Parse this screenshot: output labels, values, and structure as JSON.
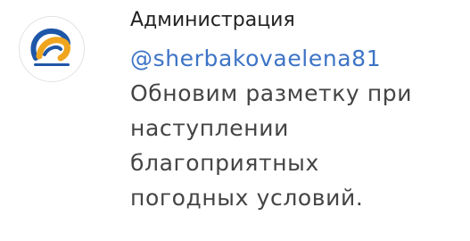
{
  "comment": {
    "author": "Администрация",
    "mention": "@sherbakovaelena81",
    "text_lines": [
      "Обновим разметку при",
      "наступлении",
      "благоприятных",
      "погодных условий."
    ],
    "avatar": {
      "icon": "organization-logo-icon",
      "colors": {
        "blue": "#1f57a8",
        "orange": "#f0a51e"
      }
    }
  }
}
